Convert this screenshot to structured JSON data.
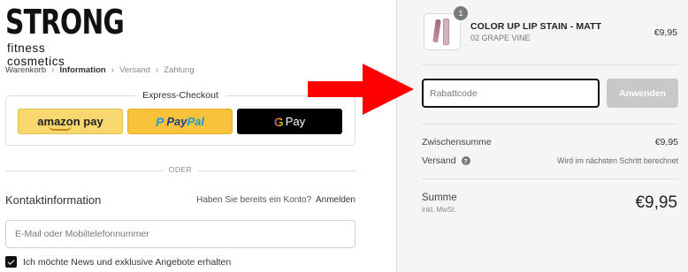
{
  "brand": {
    "name": "STRONG",
    "tagline": "fitness cosmetics"
  },
  "breadcrumb": [
    {
      "label": "Warenkorb",
      "state": "done"
    },
    {
      "label": "Information",
      "state": "active"
    },
    {
      "label": "Versand",
      "state": "upcoming"
    },
    {
      "label": "Zahlung",
      "state": "upcoming"
    }
  ],
  "express": {
    "title": "Express-Checkout",
    "amazon": "amazon pay",
    "paypal_pay": "Pay",
    "paypal_pal": "Pal",
    "gpay_g": "G",
    "gpay_label": "Pay"
  },
  "or_label": "ODER",
  "contact": {
    "title": "Kontaktinformation",
    "account_question": "Haben Sie bereits ein Konto?",
    "login_link": "Anmelden",
    "email_placeholder": "E-Mail oder Mobiltelefonnummer",
    "newsletter_label": "Ich möchte News und exklusive Angebote erhalten",
    "newsletter_checked": true
  },
  "cart": {
    "item_name": "COLOR UP LIP STAIN - MATT",
    "item_variant": "02 GRAPE VINE",
    "item_price": "€9,95",
    "item_quantity": "1"
  },
  "discount": {
    "placeholder": "Rabattcode",
    "apply_label": "Anwenden"
  },
  "summary": {
    "subtotal_label": "Zwischensumme",
    "subtotal_value": "€9,95",
    "shipping_label": "Versand",
    "shipping_value": "Wird im nächsten Schritt berechnet",
    "total_label": "Summe",
    "total_sub": "inkl. MwSt.",
    "total_value": "€9,95"
  },
  "colors": {
    "annotation_arrow": "#ff0000",
    "amazon_button": "#f7d76e",
    "paypal_button": "#f8c23a",
    "gpay_button": "#000000",
    "apply_button_disabled": "#c8c8c8",
    "sidebar_bg": "#f5f5f5"
  },
  "icons": [
    "help-icon",
    "chevron-right-icon",
    "checkmark-icon",
    "arrow-annotation"
  ]
}
